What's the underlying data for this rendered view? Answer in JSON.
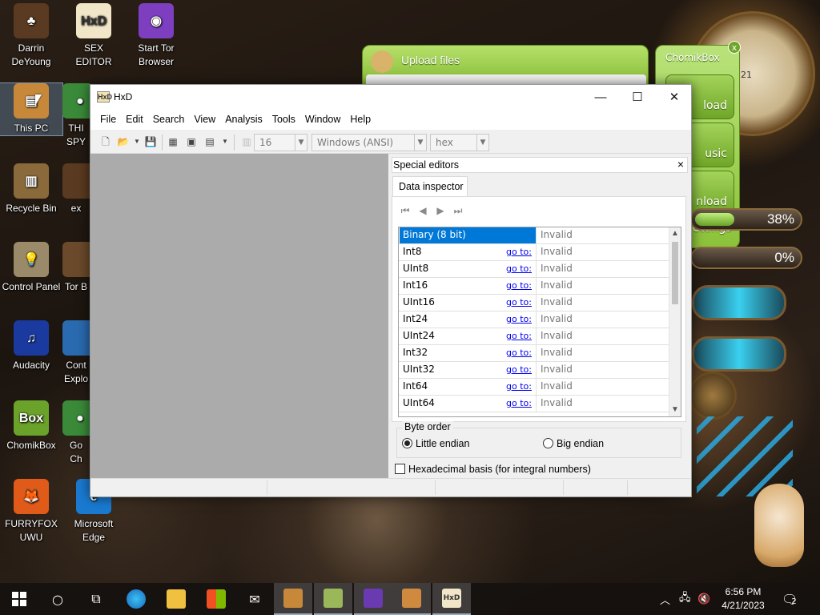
{
  "desktop": {
    "icons": [
      {
        "label_1": "Darrin",
        "label_2": "DeYoung",
        "color": "#5a3a20",
        "glyph": "♣"
      },
      {
        "label_1": "SEX",
        "label_2": "EDITOR",
        "color": "#f2e6c8",
        "glyph": "HxD"
      },
      {
        "label_1": "Start Tor",
        "label_2": "Browser",
        "color": "#7d3fbf",
        "glyph": "◉"
      },
      {
        "label_1": "This PC",
        "label_2": "",
        "color": "#c8883a",
        "glyph": "▤"
      },
      {
        "label_1": "THI",
        "label_2": "SPY",
        "color": "#3a8a3a",
        "glyph": "●"
      },
      {
        "label_1": "Recycle Bin",
        "label_2": "",
        "color": "#8a6a3a",
        "glyph": "▥"
      },
      {
        "label_1": "ex",
        "label_2": "",
        "color": "#5a3a20",
        "glyph": ""
      },
      {
        "label_1": "Control Panel",
        "label_2": "",
        "color": "#9a8a6a",
        "glyph": "💡"
      },
      {
        "label_1": "Tor B",
        "label_2": "",
        "color": "#6a4a2a",
        "glyph": ""
      },
      {
        "label_1": "Audacity",
        "label_2": "",
        "color": "#1a3aa0",
        "glyph": "♫"
      },
      {
        "label_1": "Cont",
        "label_2": "Explo",
        "color": "#2a6ab0",
        "glyph": ""
      },
      {
        "label_1": "ChomikBox",
        "label_2": "",
        "color": "#6aa22a",
        "glyph": "Box"
      },
      {
        "label_1": "Go",
        "label_2": "Ch",
        "color": "#3a8a3a",
        "glyph": "●"
      },
      {
        "label_1": "FURRYFOX",
        "label_2": "UWU",
        "color": "#e05a1a",
        "glyph": "🦊"
      },
      {
        "label_1": "Microsoft",
        "label_2": "Edge",
        "color": "#1a7ad0",
        "glyph": "e"
      }
    ]
  },
  "widget": {
    "upload_label": "Upload files",
    "chomikbox_title": "ChomikBox",
    "close_glyph": "x",
    "btn_upload": "load",
    "btn_music": "usic",
    "btn_download": "nload",
    "btn_settings": "ettings",
    "gauge_1_text": "38%",
    "gauge_1_value": 0.38,
    "gauge_2_text": "0%",
    "gauge_2_value": 0.0,
    "clock_number": "21"
  },
  "hxd": {
    "title": "HxD",
    "icon_text": "HxD",
    "minimize": "—",
    "maximize": "☐",
    "close": "✕",
    "menu": [
      "File",
      "Edit",
      "Search",
      "View",
      "Analysis",
      "Tools",
      "Window",
      "Help"
    ],
    "toolbar": {
      "columns_value": "16",
      "charset_value": "Windows (ANSI)",
      "base_value": "hex"
    },
    "special_editors": {
      "header": "Special editors",
      "close": "×",
      "tab": "Data inspector",
      "rows": [
        {
          "name": "Binary (8 bit)",
          "goto": "",
          "value": "Invalid",
          "selected": true
        },
        {
          "name": "Int8",
          "goto": "go to:",
          "value": "Invalid"
        },
        {
          "name": "UInt8",
          "goto": "go to:",
          "value": "Invalid"
        },
        {
          "name": "Int16",
          "goto": "go to:",
          "value": "Invalid"
        },
        {
          "name": "UInt16",
          "goto": "go to:",
          "value": "Invalid"
        },
        {
          "name": "Int24",
          "goto": "go to:",
          "value": "Invalid"
        },
        {
          "name": "UInt24",
          "goto": "go to:",
          "value": "Invalid"
        },
        {
          "name": "Int32",
          "goto": "go to:",
          "value": "Invalid"
        },
        {
          "name": "UInt32",
          "goto": "go to:",
          "value": "Invalid"
        },
        {
          "name": "Int64",
          "goto": "go to:",
          "value": "Invalid"
        },
        {
          "name": "UInt64",
          "goto": "go to:",
          "value": "Invalid"
        }
      ],
      "byte_order_label": "Byte order",
      "little_endian": "Little endian",
      "big_endian": "Big endian",
      "hex_basis": "Hexadecimal basis (for integral numbers)"
    }
  },
  "taskbar": {
    "time": "6:56 PM",
    "date": "4/21/2023",
    "notification_count": "2"
  },
  "colors": {
    "selection": "#0078d7",
    "link": "#0000ee",
    "widget_green": "#8cc23a"
  }
}
